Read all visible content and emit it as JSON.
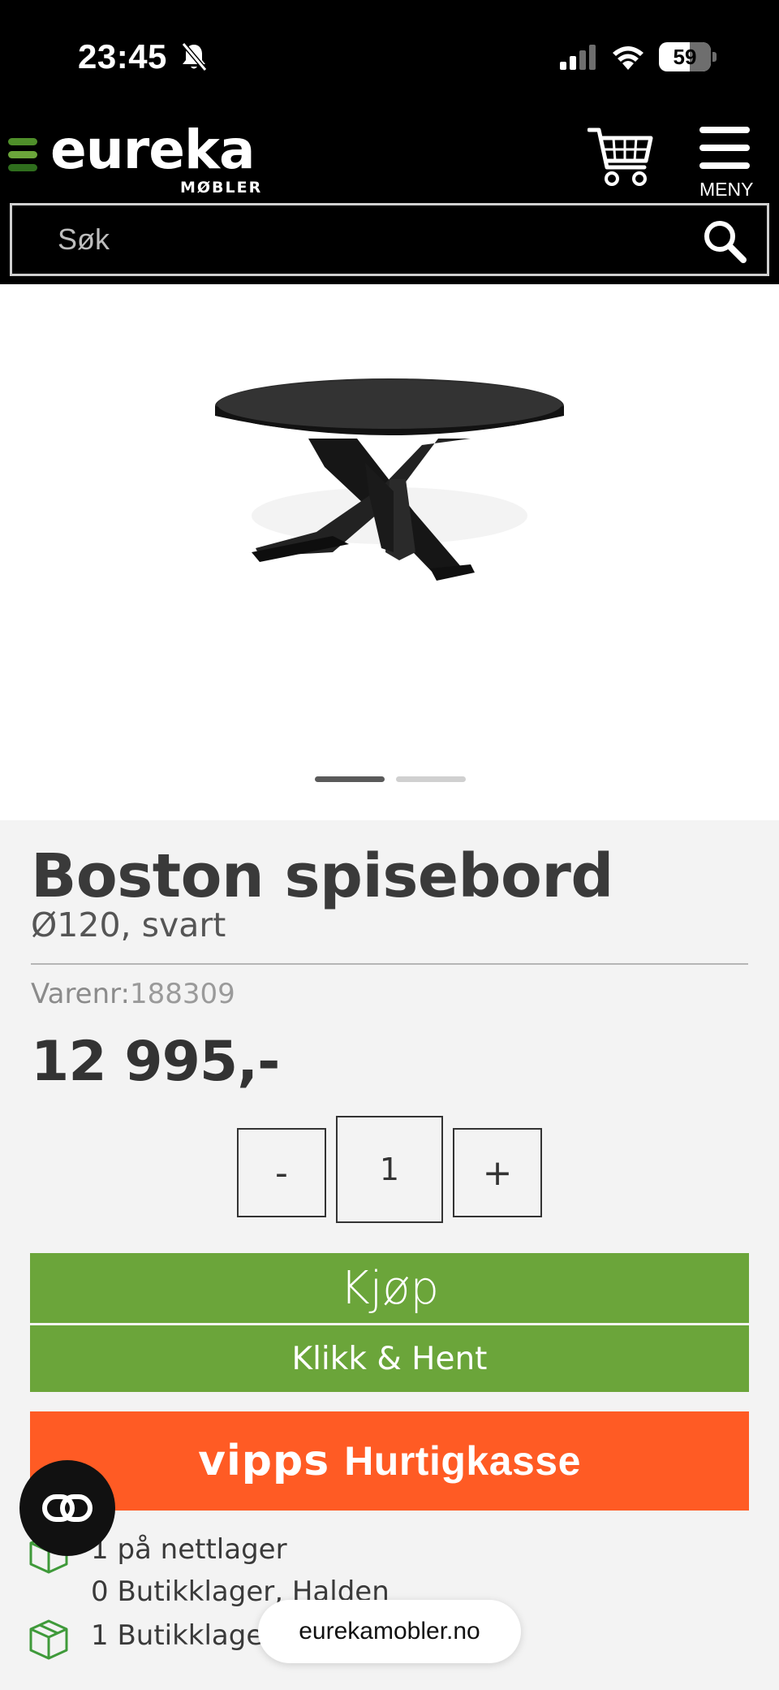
{
  "status_bar": {
    "time": "23:45",
    "battery": "59"
  },
  "header": {
    "logo_text": "eureka",
    "logo_sub": "MØBLER",
    "menu_label": "MENY",
    "search_placeholder": "Søk",
    "logo_colors": [
      "#2f6e1d",
      "#4f8f2a",
      "#6ba53a"
    ]
  },
  "gallery": {
    "image_alt": "Boston spisebord svart",
    "active_index": 0,
    "count": 2
  },
  "product": {
    "title": "Boston spisebord",
    "subtitle": "Ø120, svart",
    "sku_label": "Varenr:",
    "sku": "188309",
    "price": "12 995,-"
  },
  "quantity": {
    "minus": "-",
    "value": "1",
    "plus": "+"
  },
  "actions": {
    "buy": "Kjøp",
    "click_collect": "Klikk & Hent",
    "vipps_logo": "vipps",
    "vipps_label": "Hurtigkasse"
  },
  "stock": [
    {
      "text": "1 på nettlager"
    },
    {
      "text": "0 Butikklager, Halden"
    },
    {
      "text": "1 Butikklager, ..."
    }
  ],
  "browser": {
    "url": "eurekamobler.no"
  },
  "colors": {
    "green": "#6ba53a",
    "vipps": "#ff5b24"
  }
}
